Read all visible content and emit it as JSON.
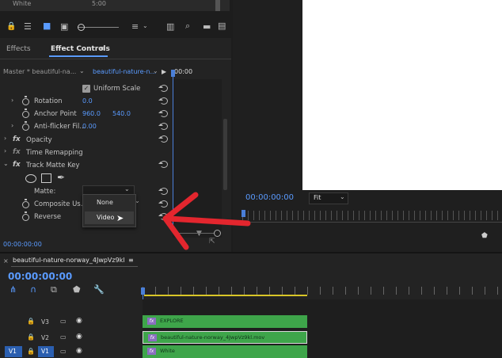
{
  "top_bin": {
    "name": "White",
    "duration": "5:00"
  },
  "tabs": {
    "effects": "Effects",
    "effect_controls": "Effect Controls",
    "menu": "≡"
  },
  "ec_header": {
    "master": "Master * beautiful-na...",
    "clip": "beautiful-nature-n...",
    "play": "▶",
    "timecode": "00:00"
  },
  "properties": {
    "uniform_scale": "Uniform Scale",
    "rotation": {
      "label": "Rotation",
      "value": "0.0"
    },
    "anchor_point": {
      "label": "Anchor Point",
      "x": "960.0",
      "y": "540.0"
    },
    "anti_flicker": {
      "label": "Anti-flicker Fil...",
      "value": "0.00"
    },
    "opacity": "Opacity",
    "time_remapping": "Time Remapping",
    "track_matte": "Track Matte Key",
    "matte": "Matte:",
    "composite": "Composite Us...",
    "reverse": "Reverse"
  },
  "dropdown": {
    "options": [
      "None",
      "Video"
    ]
  },
  "ec_footer": {
    "timecode": "00:00:00:00"
  },
  "program": {
    "timecode": "00:00:00:00",
    "zoom": "Fit"
  },
  "sequence": {
    "name": "beautiful-nature-norway_4JwpVz9kl",
    "menu": "≡",
    "timecode": "00:00:00:00"
  },
  "tracks": [
    {
      "label": "V3",
      "clip": "EXPLORE"
    },
    {
      "label": "V2",
      "clip": "beautiful-nature-norway_4JwpVz9kl.mov"
    },
    {
      "label": "V1",
      "source": "V1",
      "clip": "White"
    }
  ],
  "annotation": {
    "arrow_color": "#e3262e"
  },
  "colors": {
    "accent": "#5a9bff",
    "clip_green": "#3ea54a"
  }
}
